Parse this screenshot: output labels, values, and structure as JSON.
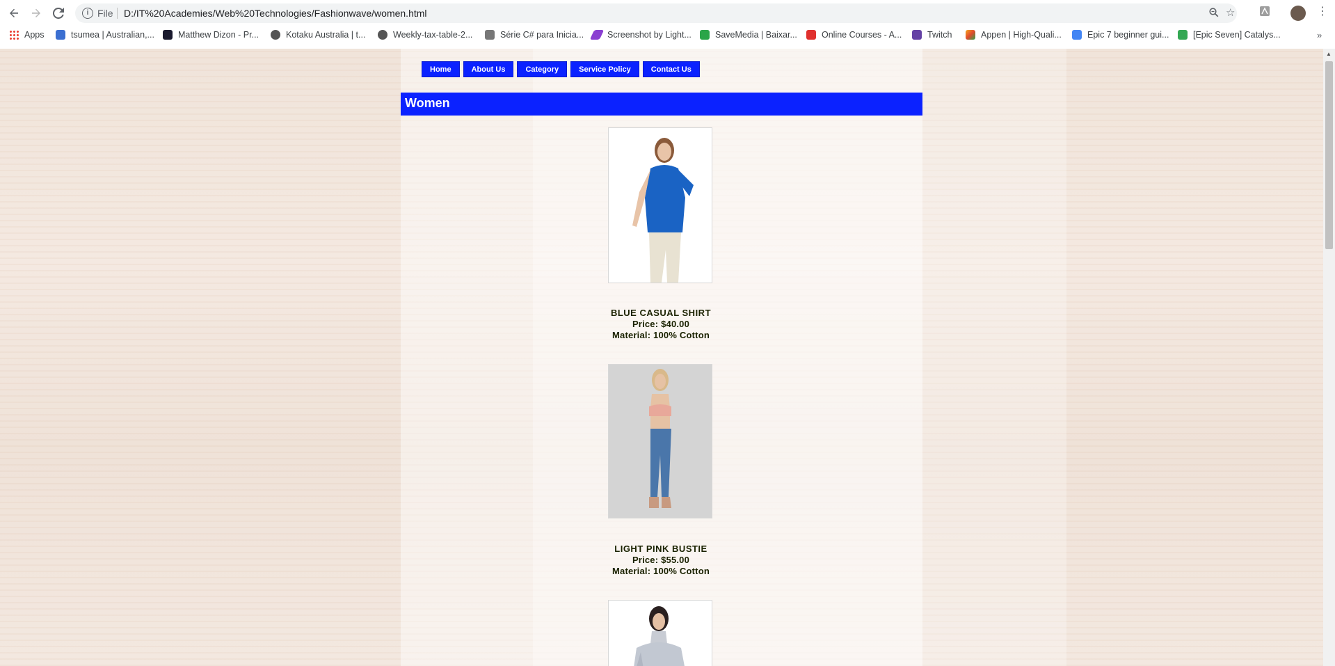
{
  "browser": {
    "omnibox": {
      "scheme_label": "File",
      "url": "D:/IT%20Academies/Web%20Technologies/Fashionwave/women.html"
    },
    "icons": {
      "back": "arrow-left-icon",
      "forward": "arrow-right-icon",
      "reload": "reload-icon",
      "info": "info-icon",
      "zoom": "zoom-icon",
      "bookmark": "star-icon",
      "extension": "pdf-extension-icon",
      "menu": "kebab-menu-icon"
    },
    "bookmarks": [
      {
        "label": "Apps",
        "color": "#ea4335"
      },
      {
        "label": "tsumea | Australian,...",
        "color": "#3b6fd1"
      },
      {
        "label": "Matthew Dizon - Pr...",
        "color": "#1a1a2e"
      },
      {
        "label": "Kotaku Australia | t...",
        "color": "#555555"
      },
      {
        "label": "Weekly-tax-table-2...",
        "color": "#555555"
      },
      {
        "label": "Série C# para Inicia...",
        "color": "#777777"
      },
      {
        "label": "Screenshot by Light...",
        "color": "#8a3fd1"
      },
      {
        "label": "SaveMedia | Baixar...",
        "color": "#2aa548"
      },
      {
        "label": "Online Courses - A...",
        "color": "#e0312e"
      },
      {
        "label": "Twitch",
        "color": "#6441a5"
      },
      {
        "label": "Appen | High-Quali...",
        "color": "#f4a71d"
      },
      {
        "label": "Epic 7 beginner gui...",
        "color": "#4285f4"
      },
      {
        "label": "[Epic Seven] Catalys...",
        "color": "#34a853"
      }
    ],
    "more_bookmarks": "»"
  },
  "site": {
    "nav": [
      "Home",
      "About Us",
      "Category",
      "Service Policy",
      "Contact Us"
    ],
    "page_title": "Women",
    "accent_color": "#0b22ff",
    "products": [
      {
        "name": "BLUE CASUAL SHIRT",
        "price": "Price: $40.00",
        "material": "Material: 100% Cotton"
      },
      {
        "name": "LIGHT PINK BUSTIE",
        "price": "Price: $55.00",
        "material": "Material: 100% Cotton"
      },
      {
        "name": "",
        "price": "",
        "material": ""
      }
    ]
  }
}
